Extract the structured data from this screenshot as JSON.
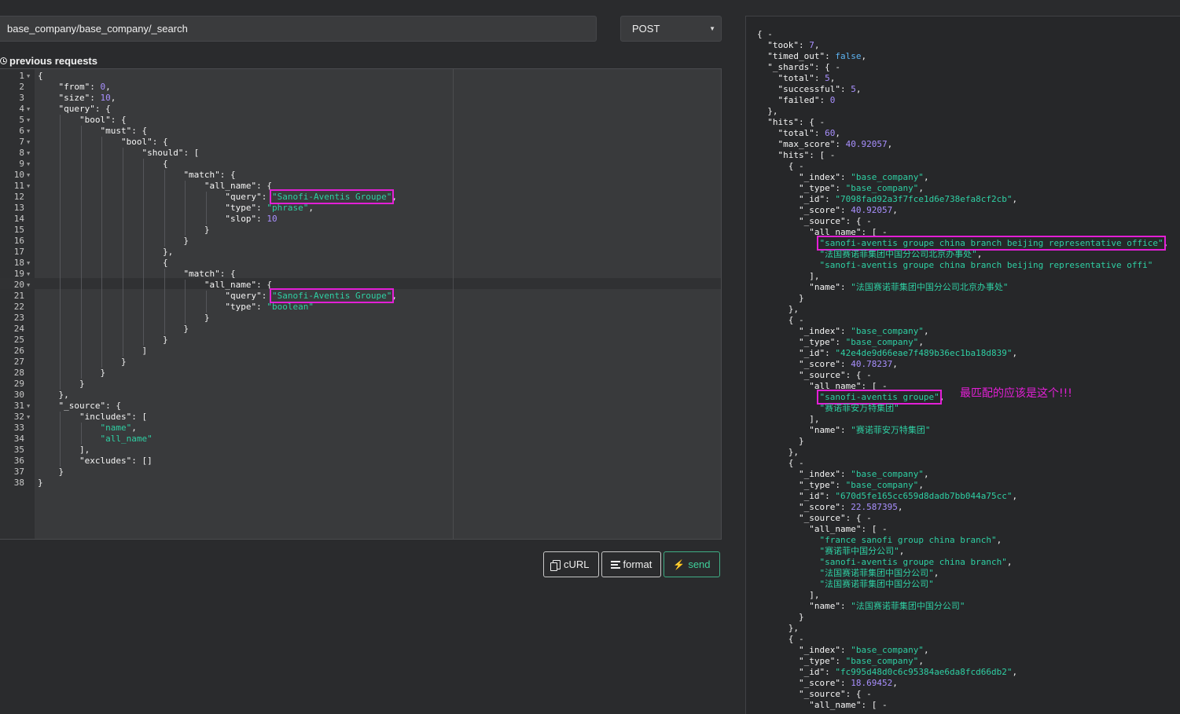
{
  "request": {
    "url": "base_company/base_company/_search",
    "method": "POST",
    "history_label": "previous requests"
  },
  "editor": {
    "lines": [
      {
        "n": "1",
        "fold": true,
        "code": "{"
      },
      {
        "n": "2",
        "code": "    \"from\": 0,"
      },
      {
        "n": "3",
        "code": "    \"size\": 10,"
      },
      {
        "n": "4",
        "fold": true,
        "code": "    \"query\": {"
      },
      {
        "n": "5",
        "fold": true,
        "code": "        \"bool\": {"
      },
      {
        "n": "6",
        "fold": true,
        "code": "            \"must\": {"
      },
      {
        "n": "7",
        "fold": true,
        "code": "                \"bool\": {"
      },
      {
        "n": "8",
        "fold": true,
        "code": "                    \"should\": ["
      },
      {
        "n": "9",
        "fold": true,
        "code": "                        {"
      },
      {
        "n": "10",
        "fold": true,
        "code": "                            \"match\": {"
      },
      {
        "n": "11",
        "fold": true,
        "code": "                                \"all_name\": {"
      },
      {
        "n": "12",
        "code": "                                    \"query\": \"Sanofi-Aventis Groupe\",",
        "highlight": "\"Sanofi-Aventis Groupe\","
      },
      {
        "n": "13",
        "code": "                                    \"type\": \"phrase\","
      },
      {
        "n": "14",
        "code": "                                    \"slop\": 10"
      },
      {
        "n": "15",
        "code": "                                }"
      },
      {
        "n": "16",
        "code": "                            }"
      },
      {
        "n": "17",
        "code": "                        },"
      },
      {
        "n": "18",
        "fold": true,
        "code": "                        {"
      },
      {
        "n": "19",
        "fold": true,
        "code": "                            \"match\": {"
      },
      {
        "n": "20",
        "fold": true,
        "code": "                                \"all_name\": {"
      },
      {
        "n": "21",
        "code": "                                    \"query\": \"Sanofi-Aventis Groupe\",",
        "highlight": "\"Sanofi-Aventis Groupe\","
      },
      {
        "n": "22",
        "code": "                                    \"type\": \"boolean\""
      },
      {
        "n": "23",
        "code": "                                }"
      },
      {
        "n": "24",
        "code": "                            }"
      },
      {
        "n": "25",
        "code": "                        }"
      },
      {
        "n": "26",
        "code": "                    ]"
      },
      {
        "n": "27",
        "code": "                }"
      },
      {
        "n": "28",
        "code": "            }"
      },
      {
        "n": "29",
        "code": "        }"
      },
      {
        "n": "30",
        "code": "    },"
      },
      {
        "n": "31",
        "fold": true,
        "code": "    \"_source\": {"
      },
      {
        "n": "32",
        "fold": true,
        "code": "        \"includes\": ["
      },
      {
        "n": "33",
        "code": "            \"name\","
      },
      {
        "n": "34",
        "code": "            \"all_name\""
      },
      {
        "n": "35",
        "code": "        ],"
      },
      {
        "n": "36",
        "code": "        \"excludes\": []"
      },
      {
        "n": "37",
        "code": "    }"
      },
      {
        "n": "38",
        "code": "}"
      }
    ]
  },
  "buttons": {
    "curl": "cURL",
    "format": "format",
    "send": "send"
  },
  "response": {
    "lines": [
      {
        "code": "{ -"
      },
      {
        "code": "  \"took\": 7,"
      },
      {
        "code": "  \"timed_out\": false,"
      },
      {
        "code": "  \"_shards\": { -"
      },
      {
        "code": "    \"total\": 5,"
      },
      {
        "code": "    \"successful\": 5,"
      },
      {
        "code": "    \"failed\": 0"
      },
      {
        "code": "  },"
      },
      {
        "code": "  \"hits\": { -"
      },
      {
        "code": "    \"total\": 60,"
      },
      {
        "code": "    \"max_score\": 40.92057,"
      },
      {
        "code": "    \"hits\": [ -"
      },
      {
        "code": "      { -"
      },
      {
        "code": "        \"_index\": \"base_company\","
      },
      {
        "code": "        \"_type\": \"base_company\","
      },
      {
        "code": "        \"_id\": \"7098fad92a3f7fce1d6e738efa8cf2cb\","
      },
      {
        "code": "        \"_score\": 40.92057,"
      },
      {
        "code": "        \"_source\": { -"
      },
      {
        "code": "          \"all_name\": [ -"
      },
      {
        "code": "            \"sanofi-aventis groupe china branch beijing representative office\",",
        "highlight": "sanofi-aventis groupe"
      },
      {
        "code": "            \"法国赛诺菲集团中国分公司北京办事处\","
      },
      {
        "code": "            \"sanofi-aventis groupe china branch beijing representative offi\""
      },
      {
        "code": "          ],"
      },
      {
        "code": "          \"name\": \"法国赛诺菲集团中国分公司北京办事处\""
      },
      {
        "code": "        }"
      },
      {
        "code": "      },"
      },
      {
        "code": "      { -"
      },
      {
        "code": "        \"_index\": \"base_company\","
      },
      {
        "code": "        \"_type\": \"base_company\","
      },
      {
        "code": "        \"_id\": \"42e4de9d66eae7f489b36ec1ba18d839\","
      },
      {
        "code": "        \"_score\": 40.78237,"
      },
      {
        "code": "        \"_source\": { -"
      },
      {
        "code": "          \"all_name\": [ -"
      },
      {
        "code": "            \"sanofi-aventis groupe\",",
        "highlight": "sanofi-aventis groupe\","
      },
      {
        "code": "            \"赛诺菲安万特集团\""
      },
      {
        "code": "          ],"
      },
      {
        "code": "          \"name\": \"赛诺菲安万特集团\""
      },
      {
        "code": "        }"
      },
      {
        "code": "      },"
      },
      {
        "code": "      { -"
      },
      {
        "code": "        \"_index\": \"base_company\","
      },
      {
        "code": "        \"_type\": \"base_company\","
      },
      {
        "code": "        \"_id\": \"670d5fe165cc659d8dadb7bb044a75cc\","
      },
      {
        "code": "        \"_score\": 22.587395,"
      },
      {
        "code": "        \"_source\": { -"
      },
      {
        "code": "          \"all_name\": [ -"
      },
      {
        "code": "            \"france sanofi group china branch\","
      },
      {
        "code": "            \"赛诺菲中国分公司\","
      },
      {
        "code": "            \"sanofi-aventis groupe china branch\","
      },
      {
        "code": "            \"法国赛诺菲集团中国分公司\","
      },
      {
        "code": "            \"法国赛诺菲集团中国分公司\""
      },
      {
        "code": "          ],"
      },
      {
        "code": "          \"name\": \"法国赛诺菲集团中国分公司\""
      },
      {
        "code": "        }"
      },
      {
        "code": "      },"
      },
      {
        "code": "      { -"
      },
      {
        "code": "        \"_index\": \"base_company\","
      },
      {
        "code": "        \"_type\": \"base_company\","
      },
      {
        "code": "        \"_id\": \"fc995d48d0c6c95384ae6da8fcd66db2\","
      },
      {
        "code": "        \"_score\": 18.69452,"
      },
      {
        "code": "        \"_source\": { -"
      },
      {
        "code": "          \"all_name\": [ -"
      }
    ],
    "annotation": "最匹配的应该是这个!!!"
  },
  "colors": {
    "string": "#2fcfa3",
    "number": "#a990ff",
    "boolean": "#5db3f2",
    "highlight_box": "#e31fd6",
    "send_button": "#3fcf9a"
  }
}
